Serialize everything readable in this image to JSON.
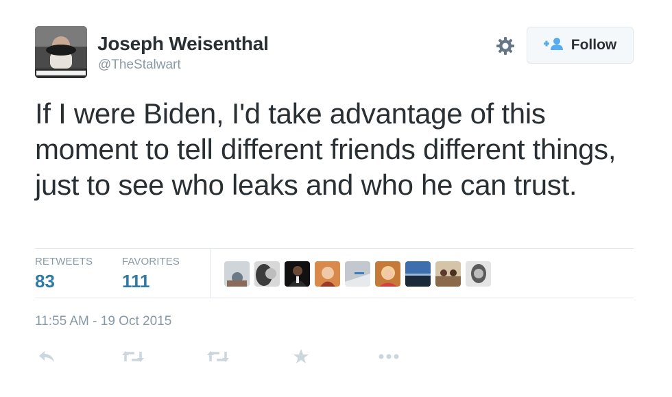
{
  "user": {
    "display_name": "Joseph Weisenthal",
    "handle": "@TheStalwart",
    "avatar_caption": "GREECE ON THE BRINK"
  },
  "follow_button": {
    "label": "Follow"
  },
  "tweet": {
    "text": "If I were Biden, I'd take advantage of this moment to tell different friends different things, just to see who leaks and who he can trust."
  },
  "stats": {
    "retweets": {
      "label": "RETWEETS",
      "value": "83"
    },
    "favorites": {
      "label": "FAVORITES",
      "value": "111"
    }
  },
  "favoriters": [
    {
      "icon": "user-avatar-1",
      "color": "#cfd5d8"
    },
    {
      "icon": "user-avatar-2",
      "color": "#6e6e6e"
    },
    {
      "icon": "user-avatar-3",
      "color": "#1e1e1e"
    },
    {
      "icon": "user-avatar-4",
      "color": "#c98a5a"
    },
    {
      "icon": "user-avatar-5",
      "color": "#b7bec4"
    },
    {
      "icon": "user-avatar-6",
      "color": "#d6a46f"
    },
    {
      "icon": "user-avatar-7",
      "color": "#3d6fae"
    },
    {
      "icon": "user-avatar-8",
      "color": "#a88a6a"
    },
    {
      "icon": "user-avatar-9",
      "color": "#9a9a9a"
    }
  ],
  "timestamp": "11:55 AM - 19 Oct 2015",
  "actions": [
    "reply-icon",
    "retweet-icon",
    "retweet-icon",
    "favorite-icon",
    "more-icon"
  ],
  "colors": {
    "text": "#292f33",
    "muted": "#8899a6",
    "stat_value": "#2f7ba5",
    "action_icon": "#ccd6dd",
    "border": "#e1e8ed",
    "follow_icon": "#55acee"
  }
}
